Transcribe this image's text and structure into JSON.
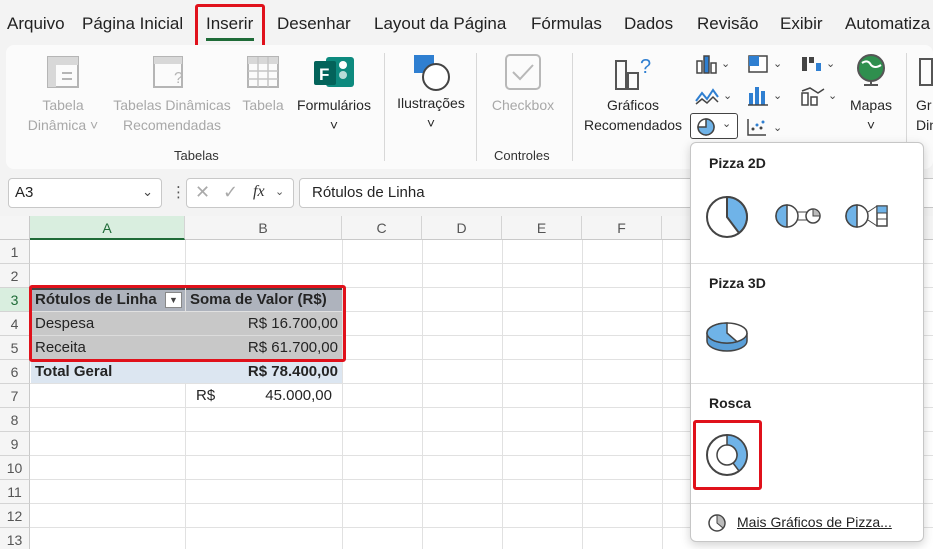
{
  "menu": {
    "items": [
      "Arquivo",
      "Página Inicial",
      "Inserir",
      "Desenhar",
      "Layout da Página",
      "Fórmulas",
      "Dados",
      "Revisão",
      "Exibir",
      "Automatiza"
    ]
  },
  "ribbon": {
    "tabela_dinamica": [
      "Tabela",
      "Dinâmica"
    ],
    "tabelas_recomendadas": [
      "Tabelas Dinâmicas",
      "Recomendadas"
    ],
    "tabela": "Tabela",
    "formularios": "Formulários",
    "tabelas_group": "Tabelas",
    "ilustracoes": "Ilustrações",
    "checkbox": "Checkbox",
    "controles_group": "Controles",
    "graficos_recomendados": [
      "Gráficos",
      "Recomendados"
    ],
    "mapas": "Mapas",
    "cut_label": [
      "Gr",
      "Dinâ"
    ]
  },
  "formula_bar": {
    "name_box": "A3",
    "fx": "fx",
    "formula": "Rótulos de Linha"
  },
  "sheet": {
    "columns": [
      "A",
      "B",
      "C",
      "D",
      "E",
      "F"
    ],
    "rows": [
      "1",
      "2",
      "3",
      "4",
      "5",
      "6",
      "7",
      "8",
      "9",
      "10",
      "11",
      "12",
      "13"
    ],
    "pivot": {
      "header_label": "Rótulos de Linha",
      "header_value": "Soma de Valor (R$)",
      "rows": [
        {
          "label": "Despesa",
          "value": "R$ 16.700,00"
        },
        {
          "label": "Receita",
          "value": "R$ 61.700,00"
        }
      ],
      "total_label": "Total Geral",
      "total_value": "R$ 78.400,00"
    },
    "b7_currency": "R$",
    "b7_value": "45.000,00"
  },
  "dropdown": {
    "section1": "Pizza 2D",
    "section2": "Pizza 3D",
    "section3": "Rosca",
    "more": "Mais Gráficos de Pizza..."
  },
  "colors": {
    "accent_green": "#1e6b37",
    "highlight_red": "#e0111b",
    "pie_blue": "#6fb3e8",
    "pivot_header": "#aeb3bd",
    "pivot_row": "#c8c8c8",
    "pivot_total": "#dce6f1"
  }
}
